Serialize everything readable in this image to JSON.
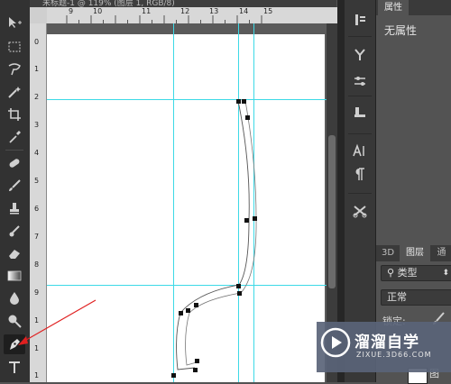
{
  "document": {
    "tab_title": "未标题-1 @ 119% (图层 1, RGB/8)"
  },
  "ruler_top_labels": [
    "9",
    "10",
    "11",
    "12",
    "13",
    "14",
    "15"
  ],
  "ruler_left_labels": [
    "0",
    "1",
    "2",
    "3",
    "4",
    "5",
    "6",
    "7",
    "8",
    "9",
    "1",
    "1",
    "1"
  ],
  "properties_panel": {
    "tab": "属性",
    "content": "无属性"
  },
  "layers_panel": {
    "tabs": [
      "3D",
      "图层",
      "通"
    ],
    "filter_kind": "类型",
    "blend_mode": "正常",
    "lock_label": "锁定:",
    "layer_name_partial": "图"
  },
  "watermark": {
    "brand": "溜溜自学",
    "site": "ZIXUE.3D66.COM"
  },
  "colors": {
    "guide": "#3dd9e6",
    "annotation_arrow": "#e02020",
    "canvas": "#ffffff"
  }
}
